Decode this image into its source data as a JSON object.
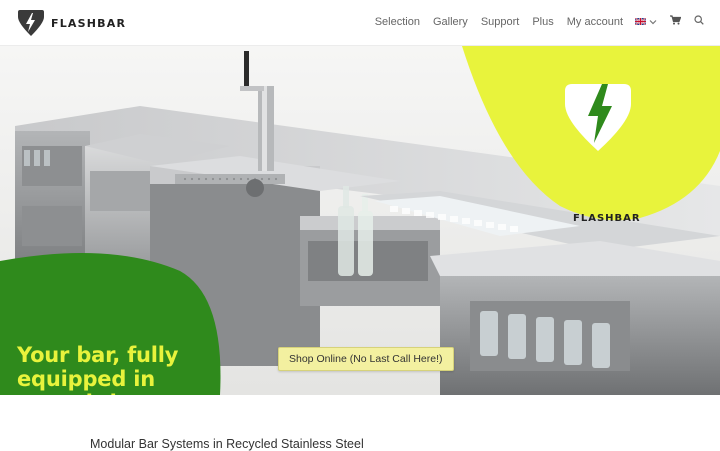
{
  "brand": {
    "name": "FLASHBAR"
  },
  "nav": {
    "items": [
      "Selection",
      "Gallery",
      "Support",
      "Plus",
      "My account"
    ],
    "language_icon": "uk-flag-icon",
    "cart_icon": "cart-icon",
    "search_icon": "search-icon"
  },
  "hero": {
    "headline": "Your bar, fully equipped in record time.",
    "cta_label": "Shop Online (No Last Call Here!)",
    "badge_brand": "FLASHBAR"
  },
  "content": {
    "subtitle": "Modular Bar Systems in Recycled Stainless Steel"
  },
  "colors": {
    "accent_yellow": "#e8f33c",
    "accent_green": "#2f8a1c",
    "cta_bg": "#f3f0a0"
  }
}
